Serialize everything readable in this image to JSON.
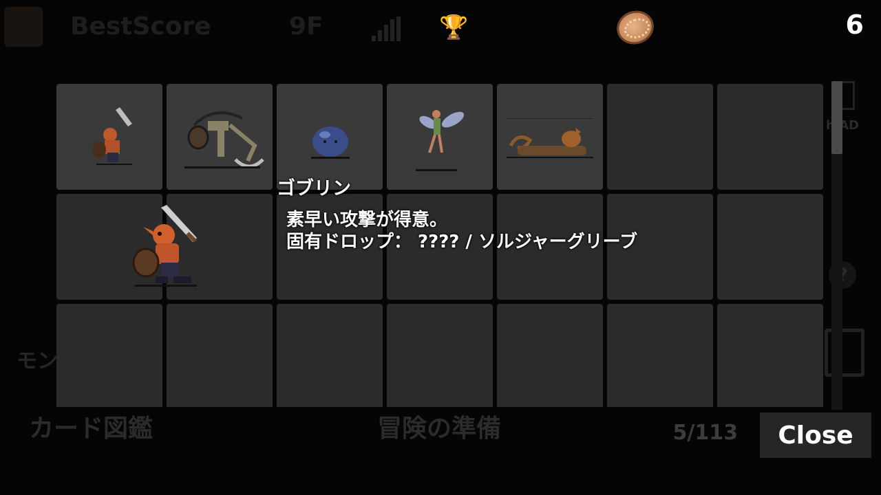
{
  "background": {
    "best_score_label": "BestScore",
    "floor_label": "9F",
    "ad_label": "h AD",
    "help_symbol": "?",
    "monster_label": "モン",
    "card_book_label": "カード図鑑",
    "preparation_label": "冒険の準備"
  },
  "header": {
    "coin_icon": "coin-icon",
    "coin_count": "6"
  },
  "grid": {
    "columns": 7,
    "visible_rows": 3,
    "cells": [
      {
        "monster": "goblin",
        "discovered": true
      },
      {
        "monster": "skeleton-reaper",
        "discovered": true
      },
      {
        "monster": "blue-slime",
        "discovered": true
      },
      {
        "monster": "fairy",
        "discovered": true
      },
      {
        "monster": "scorpion-dragon",
        "discovered": true
      },
      {
        "discovered": false
      },
      {
        "discovered": false
      },
      {
        "discovered": false
      },
      {
        "discovered": false
      },
      {
        "discovered": false
      },
      {
        "discovered": false
      },
      {
        "discovered": false
      },
      {
        "discovered": false
      },
      {
        "discovered": false
      },
      {
        "discovered": false
      },
      {
        "discovered": false
      },
      {
        "discovered": false
      },
      {
        "discovered": false
      },
      {
        "discovered": false
      },
      {
        "discovered": false
      },
      {
        "discovered": false
      }
    ]
  },
  "detail": {
    "name": "ゴブリン",
    "description": "素早い攻撃が得意。",
    "drop_line": "固有ドロップ： ???? / ソルジャーグリーブ"
  },
  "footer": {
    "page_count": "5/113",
    "close_label": "Close"
  }
}
